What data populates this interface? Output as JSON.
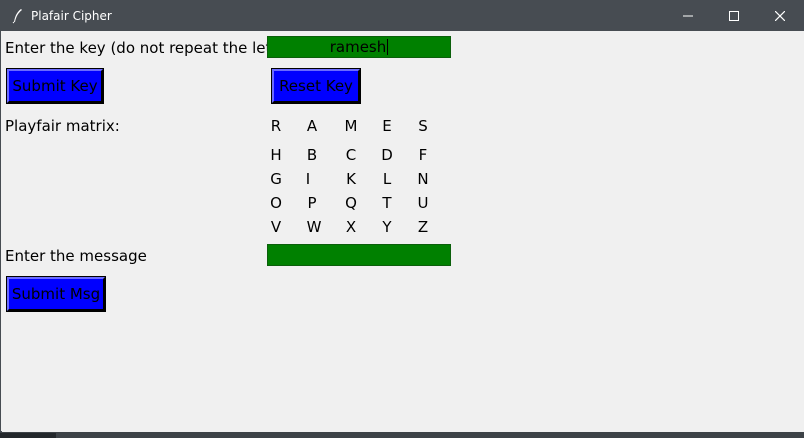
{
  "window": {
    "title": "Plafair Cipher",
    "icon": "feather-icon",
    "controls": [
      "minimize-icon",
      "maximize-icon",
      "close-icon"
    ]
  },
  "key_section": {
    "label": "Enter the key (do not repeat the letter)",
    "value": "ramesh"
  },
  "buttons": {
    "submit_key": "Submit Key",
    "reset_key": "Reset Key",
    "submit_msg": "Submit Msg"
  },
  "matrix": {
    "label": "Playfair matrix:",
    "rows": [
      [
        "R",
        "A",
        "M",
        "E",
        "S"
      ],
      [
        "H",
        "B",
        "C",
        "D",
        "F"
      ],
      [
        "G",
        "I",
        "K",
        "L",
        "N"
      ],
      [
        "O",
        "P",
        "Q",
        "T",
        "U"
      ],
      [
        "V",
        "W",
        "X",
        "Y",
        "Z"
      ]
    ]
  },
  "message_section": {
    "label": "Enter the message",
    "value": ""
  },
  "colors": {
    "entry_bg": "#008000",
    "button_bg": "#0000ff",
    "window_bg": "#f0f0f0",
    "titlebar_bg": "#474c52"
  }
}
